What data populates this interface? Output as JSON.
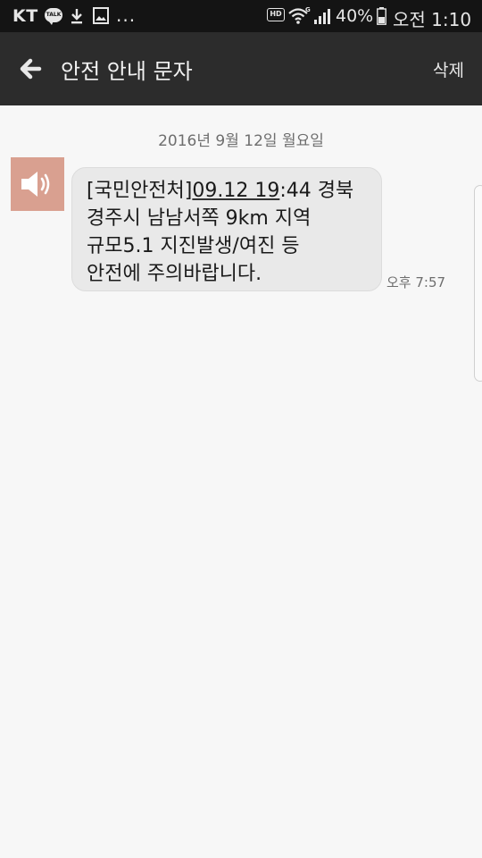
{
  "status_bar": {
    "carrier": "KT",
    "talk_badge": "TALK",
    "more": "...",
    "hd": "HD",
    "battery": "40%",
    "clock": "오전 1:10"
  },
  "app_bar": {
    "title": "안전 안내 문자",
    "delete_label": "삭제"
  },
  "conversation": {
    "date_divider": "2016년 9월 12일 월요일",
    "message": {
      "line1_prefix": "[국민안전처]",
      "line1_link": "09.12 19",
      "line1_suffix": ":44 경북",
      "line2": "경주시 남남서쪽 9km 지역",
      "line3": "규모5.1 지진발생/여진 등",
      "line4": "안전에 주의바랍니다.",
      "time": "오후 7:57"
    }
  },
  "colors": {
    "status_bar_bg": "#141414",
    "app_bar_bg": "#2c2c2c",
    "page_bg": "#f7f7f7",
    "avatar_bg": "#d9a090",
    "bubble_bg": "#e9e9e9"
  },
  "icons": {
    "avatar": "speaker-icon",
    "back": "arrow-left-icon"
  }
}
